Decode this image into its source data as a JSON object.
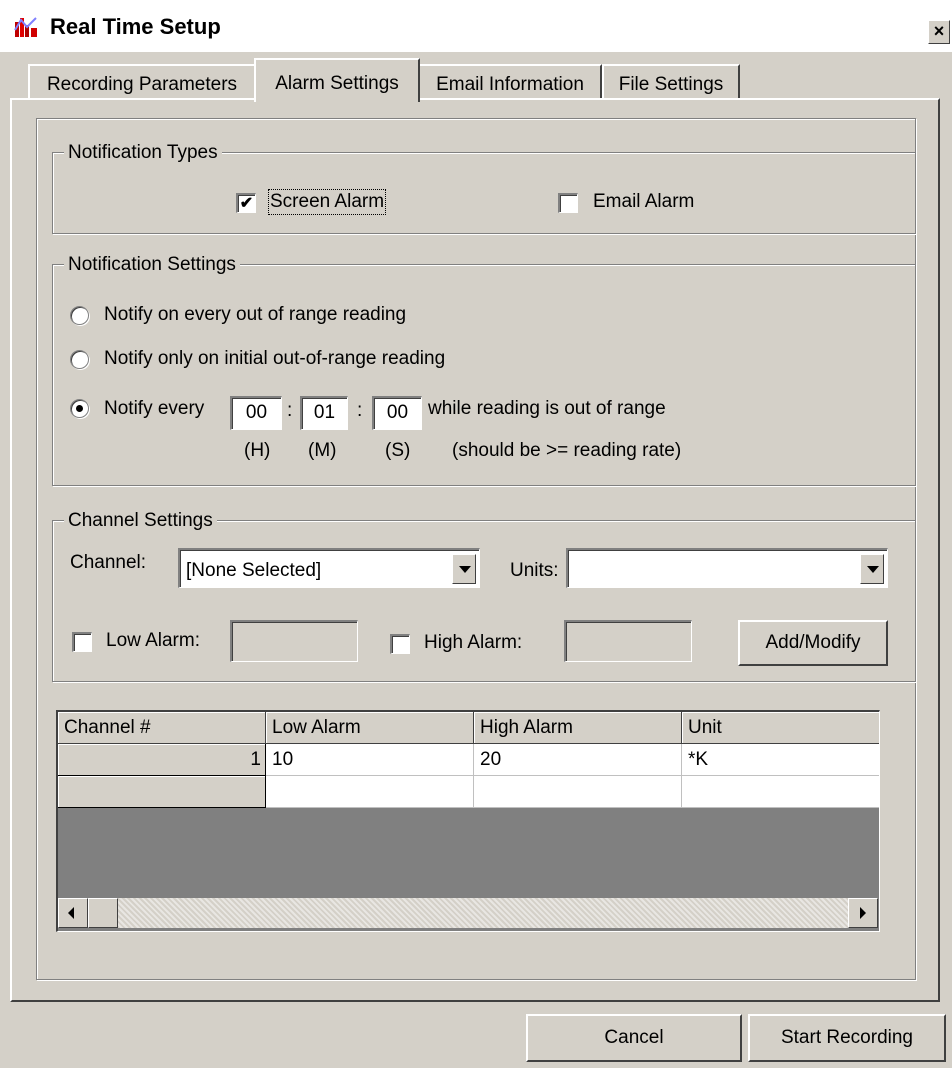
{
  "window": {
    "title": "Real Time Setup",
    "close_glyph": "×"
  },
  "tabs": [
    {
      "label": "Recording Parameters",
      "active": false
    },
    {
      "label": "Alarm Settings",
      "active": true
    },
    {
      "label": "Email Information",
      "active": false
    },
    {
      "label": "File Settings",
      "active": false
    }
  ],
  "notification_types": {
    "group_label": "Notification Types",
    "screen_alarm": {
      "label": "Screen Alarm",
      "checked": true
    },
    "email_alarm": {
      "label": "Email Alarm",
      "checked": false
    }
  },
  "notification_settings": {
    "group_label": "Notification Settings",
    "option_every": "Notify on every out of range reading",
    "option_initial": "Notify only on initial out-of-range reading",
    "option_interval_prefix": "Notify every",
    "option_interval_suffix": "while reading is out of range",
    "selected_option": "interval",
    "hours": "00",
    "minutes": "01",
    "seconds": "00",
    "separator": ":",
    "hours_label": "(H)",
    "minutes_label": "(M)",
    "seconds_label": "(S)",
    "hint": "(should be >= reading rate)"
  },
  "channel_settings": {
    "group_label": "Channel Settings",
    "channel_label": "Channel:",
    "channel_value": "[None Selected]",
    "units_label": "Units:",
    "units_value": "",
    "low_alarm_label": "Low Alarm:",
    "low_alarm_checked": false,
    "low_alarm_value": "",
    "high_alarm_label": "High Alarm:",
    "high_alarm_checked": false,
    "high_alarm_value": "",
    "add_modify_label": "Add/Modify"
  },
  "grid": {
    "columns": [
      "Channel #",
      "Low Alarm",
      "High Alarm",
      "Unit"
    ],
    "rows": [
      {
        "channel": "1",
        "low": "10",
        "high": "20",
        "unit": "*K"
      },
      {
        "channel": "",
        "low": "",
        "high": "",
        "unit": ""
      }
    ]
  },
  "footer": {
    "cancel_label": "Cancel",
    "start_label": "Start Recording"
  },
  "icons": {
    "app": "app-chart-icon",
    "check": "✔"
  }
}
